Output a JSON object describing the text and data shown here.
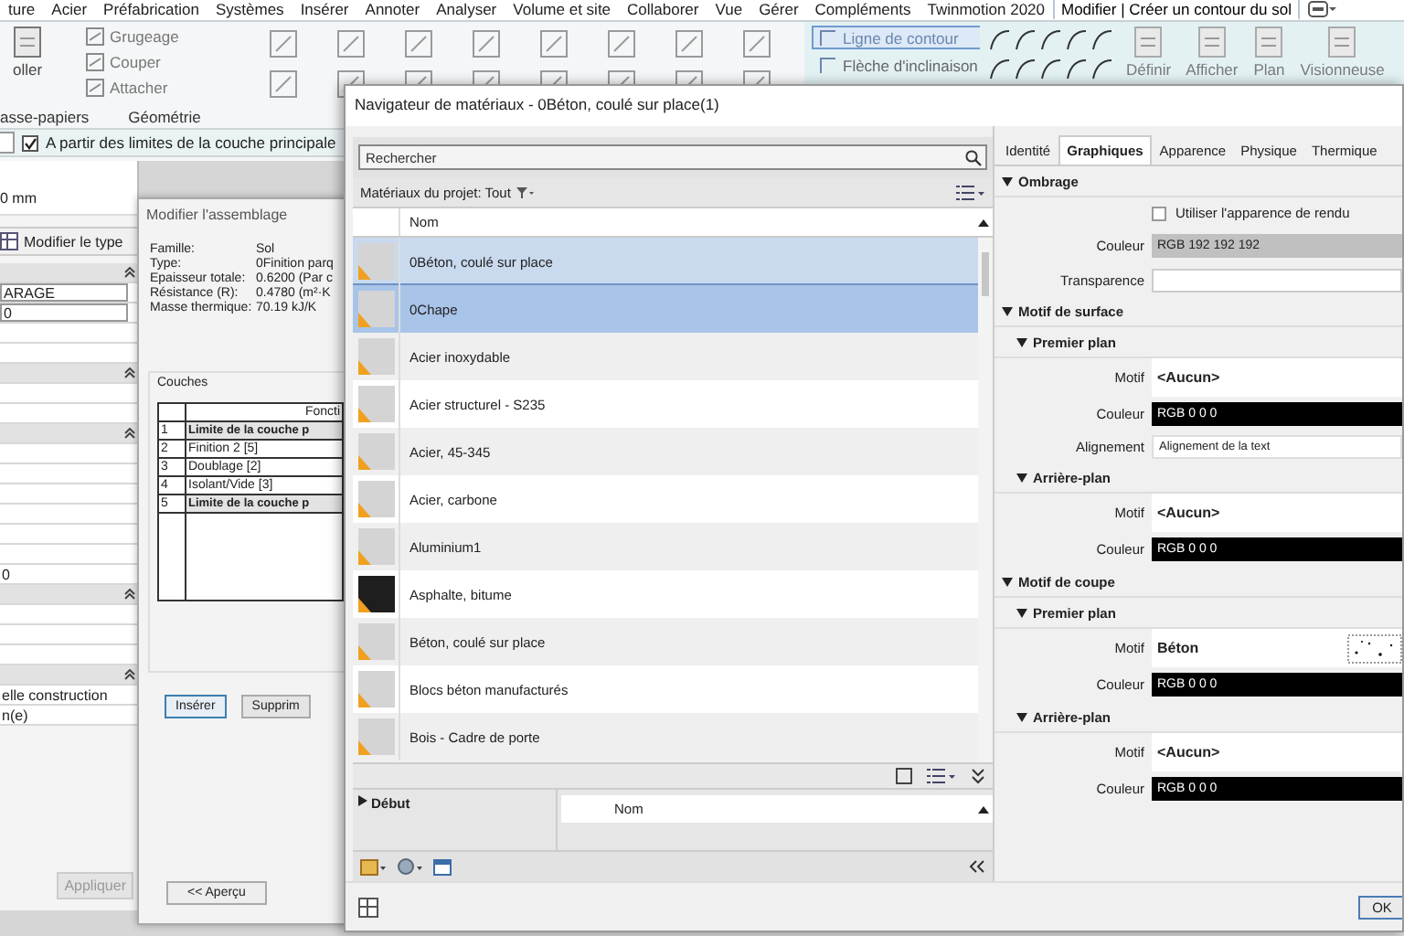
{
  "ribbon": {
    "tabs": [
      {
        "label": "ture",
        "selected": false
      },
      {
        "label": "Acier",
        "selected": false
      },
      {
        "label": "Préfabrication",
        "selected": false
      },
      {
        "label": "Systèmes",
        "selected": false
      },
      {
        "label": "Insérer",
        "selected": false
      },
      {
        "label": "Annoter",
        "selected": false
      },
      {
        "label": "Analyser",
        "selected": false
      },
      {
        "label": "Volume et site",
        "selected": false
      },
      {
        "label": "Collaborer",
        "selected": false
      },
      {
        "label": "Vue",
        "selected": false
      },
      {
        "label": "Gérer",
        "selected": false
      },
      {
        "label": "Compléments",
        "selected": false
      },
      {
        "label": "Twinmotion 2020",
        "selected": false
      },
      {
        "label": "Modifier | Créer un contour du sol",
        "selected": true
      }
    ],
    "groups": [
      {
        "label": "asse-papiers",
        "tools": [
          {
            "kind": "large",
            "label": "oller",
            "disabled": false
          }
        ]
      },
      {
        "label": "Géométrie",
        "tools": [
          {
            "kind": "small",
            "label": "Grugeage"
          },
          {
            "kind": "small",
            "label": "Couper"
          },
          {
            "kind": "small",
            "label": "Attacher"
          }
        ]
      },
      {
        "tools": [
          {
            "kind": "icons"
          }
        ]
      },
      {
        "tools": [
          {
            "kind": "toggle",
            "label": "Ligne de contour",
            "selected": true
          },
          {
            "kind": "toggle",
            "label": "Flèche d'inclinaison",
            "selected": false
          }
        ]
      },
      {
        "tools": [
          {
            "kind": "shapes"
          }
        ]
      },
      {
        "tools": [
          {
            "kind": "large",
            "label": "Définir",
            "disabled": true
          },
          {
            "kind": "large",
            "label": "Afficher",
            "disabled": true
          },
          {
            "kind": "large",
            "label": "Plan",
            "disabled": true
          },
          {
            "kind": "large",
            "label": "Visionneuse",
            "disabled": true
          }
        ]
      }
    ]
  },
  "options_bar": {
    "checkbox": {
      "label": "A partir des limites de la couche principale",
      "checked": true
    }
  },
  "properties_panel": {
    "value": "0 mm",
    "edit_type_button": "Modifier le type",
    "rows": [
      {
        "kind": "header"
      },
      {
        "kind": "value",
        "text": "ARAGE"
      },
      {
        "kind": "value",
        "text": "0"
      },
      {
        "kind": "empty"
      },
      {
        "kind": "empty"
      },
      {
        "kind": "header"
      },
      {
        "kind": "empty"
      },
      {
        "kind": "empty"
      },
      {
        "kind": "header"
      },
      {
        "kind": "empty"
      },
      {
        "kind": "empty"
      },
      {
        "kind": "empty"
      },
      {
        "kind": "empty"
      },
      {
        "kind": "empty"
      },
      {
        "kind": "empty"
      },
      {
        "kind": "value",
        "text": "0"
      },
      {
        "kind": "header"
      },
      {
        "kind": "empty"
      },
      {
        "kind": "empty"
      },
      {
        "kind": "empty"
      },
      {
        "kind": "header"
      },
      {
        "kind": "value",
        "text": "elle construction"
      },
      {
        "kind": "value",
        "text": "n(e)"
      }
    ],
    "apply_button": "Appliquer"
  },
  "assembly_dialog": {
    "title": "Modifier l'assemblage",
    "fields": [
      {
        "label": "Famille:",
        "value": "Sol"
      },
      {
        "label": "Type:",
        "value": "0Finition parq"
      },
      {
        "label": "Epaisseur totale:",
        "value": "0.6200 (Par c"
      },
      {
        "label": "Résistance (R):",
        "value": "0.4780 (m²·K"
      },
      {
        "label": "Masse thermique:",
        "value": "70.19 kJ/K"
      }
    ],
    "layers": {
      "title": "Couches",
      "column": "Foncti",
      "rows": [
        {
          "number": "1",
          "function": "Limite de la couche p",
          "kind": "boundary"
        },
        {
          "number": "2",
          "function": "Finition 2 [5]",
          "kind": "layer"
        },
        {
          "number": "3",
          "function": "Doublage [2]",
          "kind": "layer"
        },
        {
          "number": "4",
          "function": "Isolant/Vide [3]",
          "kind": "layer"
        },
        {
          "number": "5",
          "function": "Limite de la couche p",
          "kind": "boundary"
        }
      ]
    },
    "buttons": [
      "Insérer",
      "Supprim"
    ],
    "preview_button": "<< Aperçu"
  },
  "material_browser": {
    "title": "Navigateur de matériaux - 0Béton, coulé sur place(1)",
    "search": {
      "placeholder": "Rechercher"
    },
    "filter_label": "Matériaux du projet: Tout",
    "list": {
      "column": "Nom",
      "items": [
        {
          "name": "0Béton, coulé sur place",
          "selected": false,
          "in_use": true,
          "kind": "plain"
        },
        {
          "name": "0Chape",
          "selected": true,
          "in_use": false,
          "kind": "plain"
        },
        {
          "name": "Acier inoxydable",
          "selected": false,
          "in_use": false,
          "kind": "plain"
        },
        {
          "name": "Acier structurel - S235",
          "selected": false,
          "in_use": false,
          "kind": "plain"
        },
        {
          "name": "Acier, 45-345",
          "selected": false,
          "in_use": false,
          "kind": "plain"
        },
        {
          "name": "Acier, carbone",
          "selected": false,
          "in_use": false,
          "kind": "plain"
        },
        {
          "name": "Aluminium1",
          "selected": false,
          "in_use": false,
          "kind": "plain"
        },
        {
          "name": "Asphalte, bitume",
          "selected": false,
          "in_use": false,
          "kind": "dark"
        },
        {
          "name": "Béton, coulé sur place",
          "selected": false,
          "in_use": false,
          "kind": "plain"
        },
        {
          "name": "Blocs béton manufacturés",
          "selected": false,
          "in_use": false,
          "kind": "plain"
        },
        {
          "name": "Bois - Cadre de porte",
          "selected": false,
          "in_use": false,
          "kind": "plain"
        }
      ]
    },
    "library": {
      "tree_label": "Début",
      "expanded": false,
      "column": "Nom"
    },
    "editor": {
      "tabs": [
        {
          "label": "Identité",
          "selected": false
        },
        {
          "label": "Graphiques",
          "selected": true
        },
        {
          "label": "Apparence",
          "selected": false
        },
        {
          "label": "Physique",
          "selected": false
        },
        {
          "label": "Thermique",
          "selected": false
        }
      ],
      "sections": [
        {
          "title": "Ombrage",
          "expanded": true,
          "rows": [
            {
              "kind": "checkbox",
              "label": "Utiliser l'apparence de rendu",
              "checked": false
            },
            {
              "kind": "color",
              "label": "Couleur",
              "value": "RGB 192 192 192",
              "color": "#c0c0c0"
            },
            {
              "kind": "blank",
              "label": "Transparence"
            }
          ]
        },
        {
          "title": "Motif de surface",
          "expanded": true,
          "subsections": [
            {
              "title": "Premier plan",
              "expanded": true,
              "rows": [
                {
                  "kind": "pattern",
                  "label": "Motif",
                  "value": "<Aucun>"
                },
                {
                  "kind": "color",
                  "label": "Couleur",
                  "value": "RGB 0 0 0",
                  "color": "#000000"
                },
                {
                  "kind": "text",
                  "label": "Alignement",
                  "value": "Alignement de la text"
                }
              ]
            },
            {
              "title": "Arrière-plan",
              "expanded": true,
              "rows": [
                {
                  "kind": "pattern",
                  "label": "Motif",
                  "value": "<Aucun>"
                },
                {
                  "kind": "color",
                  "label": "Couleur",
                  "value": "RGB 0 0 0",
                  "color": "#000000"
                }
              ]
            }
          ]
        },
        {
          "title": "Motif de coupe",
          "expanded": true,
          "subsections": [
            {
              "title": "Premier plan",
              "expanded": true,
              "rows": [
                {
                  "kind": "pattern-preview",
                  "label": "Motif",
                  "value": "Béton"
                },
                {
                  "kind": "color",
                  "label": "Couleur",
                  "value": "RGB 0 0 0",
                  "color": "#000000"
                }
              ]
            },
            {
              "title": "Arrière-plan",
              "expanded": true,
              "rows": [
                {
                  "kind": "pattern",
                  "label": "Motif",
                  "value": "<Aucun>"
                },
                {
                  "kind": "color",
                  "label": "Couleur",
                  "value": "RGB 0 0 0",
                  "color": "#000000"
                }
              ]
            }
          ]
        }
      ]
    },
    "ok_button": "OK"
  }
}
